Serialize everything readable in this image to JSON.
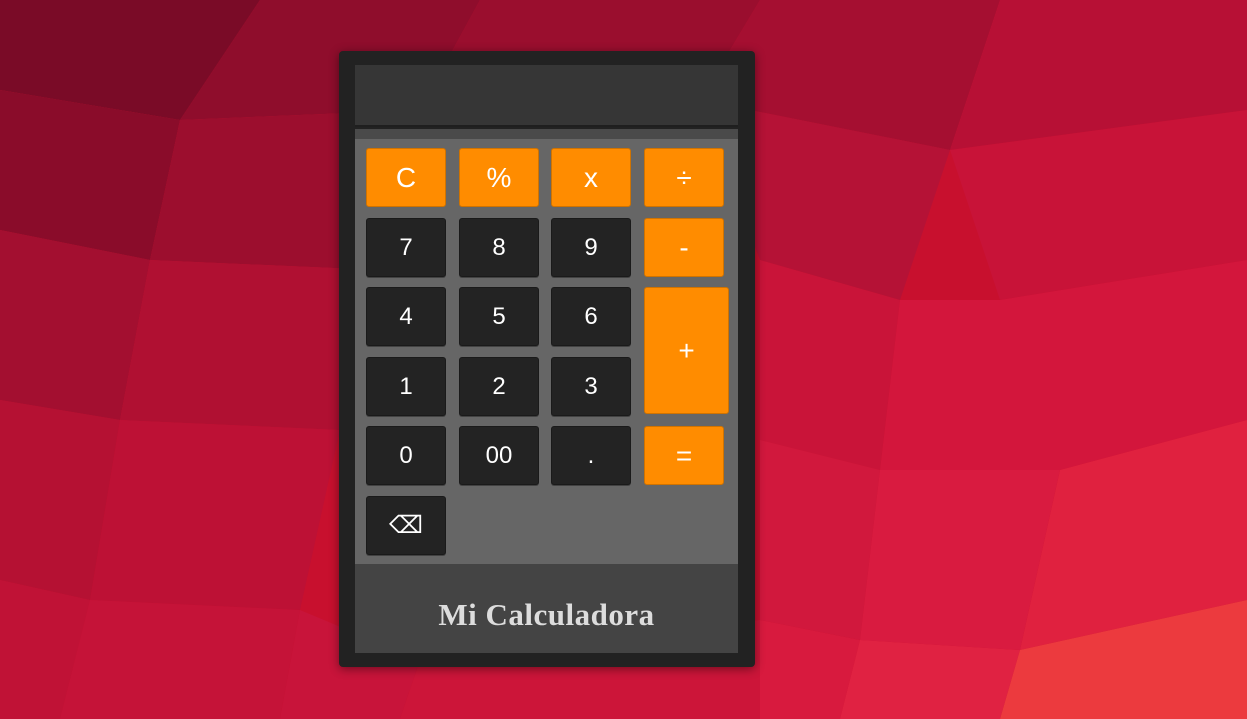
{
  "background": {
    "base_color": "#c8102e",
    "dark_color": "#6e0a22",
    "light_color": "#ef3b3e"
  },
  "calculator": {
    "display_value": "",
    "footer_title": "Mi Calculadora",
    "keys": {
      "clear": "C",
      "percent": "%",
      "multiply": "x",
      "divide": "÷",
      "seven": "7",
      "eight": "8",
      "nine": "9",
      "minus": "-",
      "four": "4",
      "five": "5",
      "six": "6",
      "plus": "+",
      "one": "1",
      "two": "2",
      "three": "3",
      "zero": "0",
      "double_zero": "00",
      "decimal": ".",
      "equals": "=",
      "backspace": "⌫"
    },
    "colors": {
      "frame": "#222222",
      "keypad": "#666666",
      "key_dark": "#232323",
      "key_accent": "#ff8c00",
      "footer": "#444444"
    }
  }
}
